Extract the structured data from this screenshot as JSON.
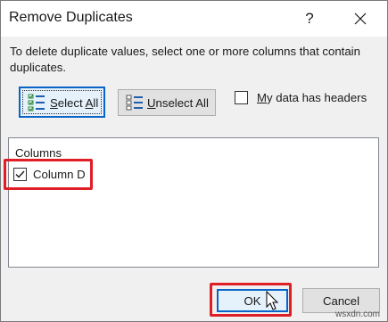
{
  "dialog": {
    "title": "Remove Duplicates",
    "help_label": "?",
    "instructions": "To delete duplicate values, select one or more columns that contain duplicates."
  },
  "buttons": {
    "select_all_underlined": "S",
    "select_all_rest": "elect ",
    "select_all_underlined2": "A",
    "select_all_rest2": "ll",
    "unselect_all_underlined": "U",
    "unselect_all_rest": "nselect All",
    "ok_label": "OK",
    "cancel_label": "Cancel"
  },
  "headers_option": {
    "underlined": "M",
    "rest": "y data has headers",
    "checked": false
  },
  "columns": {
    "header": "Columns",
    "items": [
      {
        "label": "Column D",
        "checked": true
      }
    ]
  },
  "highlight_color": "#e01e25",
  "accent_color": "#0a64c8",
  "watermark": "wsxdn.com"
}
